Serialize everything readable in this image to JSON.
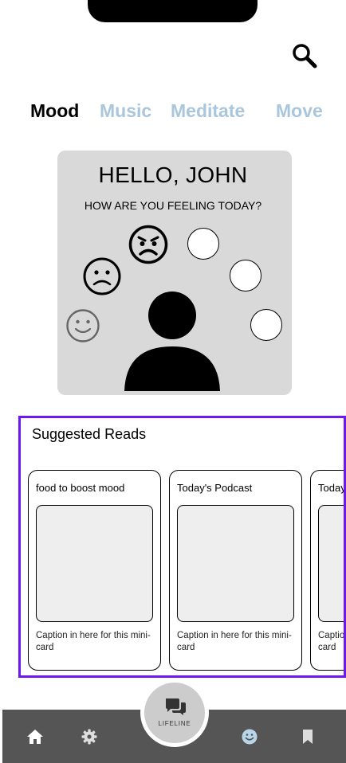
{
  "tabs": [
    {
      "label": "Mood",
      "active": true
    },
    {
      "label": "Music",
      "active": false
    },
    {
      "label": "Meditate",
      "active": false
    },
    {
      "label": "Move",
      "active": false
    }
  ],
  "hero": {
    "title": "HELLO, JOHN",
    "subtitle": "HOW ARE YOU FEELING TODAY?",
    "mood_icons": [
      "angry-face-icon",
      "sad-face-icon",
      "happy-face-icon"
    ]
  },
  "suggested": {
    "title": "Suggested Reads",
    "cards": [
      {
        "title": "food to boost mood",
        "caption": "Caption in here for this mini-card"
      },
      {
        "title": "Today's Podcast",
        "caption": "Caption in here for this mini-card"
      },
      {
        "title": "Today's Podcast",
        "caption": "Caption in here for this mini-card"
      }
    ]
  },
  "nav": {
    "lifeline_label": "LIFELINE",
    "icons": [
      "home-icon",
      "gear-icon",
      "chat-bubbles-icon",
      "smiley-icon",
      "bookmark-icon"
    ]
  },
  "colors": {
    "accent_tab": "#a9c6dd",
    "highlight_border": "#6b19f0",
    "navbar": "#555555",
    "active_nav_icon": "#b9d5ea"
  }
}
